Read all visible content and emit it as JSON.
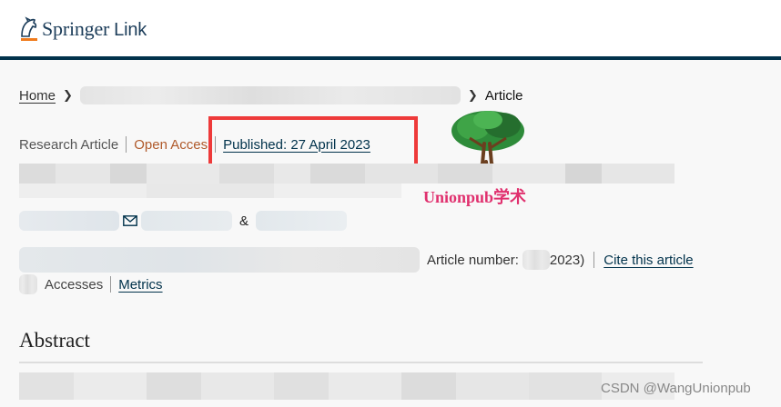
{
  "header": {
    "brand": "Springer",
    "brand_suffix": "Link"
  },
  "breadcrumb": {
    "home": "Home",
    "current": "Article"
  },
  "meta": {
    "type": "Research Article",
    "access": "Open Acces",
    "published": "Published: 27 April 2023"
  },
  "watermark": {
    "text": "Unionpub学术",
    "footer": "CSDN @WangUnionpub"
  },
  "authors": {
    "separator": "&"
  },
  "journal": {
    "article_number_label": "Article number:",
    "year_suffix": "2023)",
    "cite_label": "Cite this article"
  },
  "stats": {
    "accesses_label": "Accesses",
    "metrics_label": "Metrics"
  },
  "section": {
    "abstract_title": "Abstract"
  },
  "colors": {
    "brand_navy": "#01324b",
    "open_access": "#b05a2b",
    "highlight_red": "#ee3a3a",
    "watermark_pink": "#e0306e"
  }
}
